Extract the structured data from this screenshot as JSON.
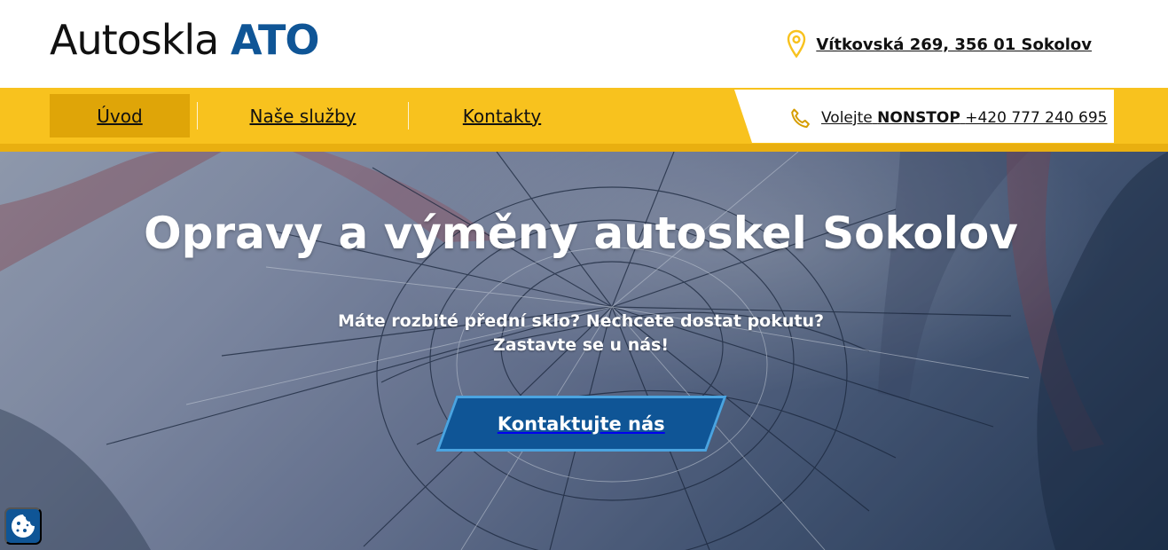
{
  "brand": {
    "name_main": "Autoskla",
    "name_accent": "ATO",
    "accent_color": "#0f5596"
  },
  "header": {
    "address": "Vítkovská 269, 356 01 Sokolov",
    "address_icon": "map-pin-icon"
  },
  "nav": {
    "items": [
      {
        "label": "Úvod",
        "active": true
      },
      {
        "label": "Naše služby",
        "active": false
      },
      {
        "label": "Kontakty",
        "active": false
      }
    ],
    "phone_prefix": "Volejte",
    "phone_nonstop": "NONSTOP",
    "phone_number": "+420 777 240 695",
    "phone_icon": "phone-icon"
  },
  "hero": {
    "title": "Opravy a výměny autoskel Sokolov",
    "subtitle_line1": "Máte rozbité přední sklo? Nechcete dostat pokutu?",
    "subtitle_line2": "Zastavte se u nás!",
    "cta": "Kontaktujte nás"
  },
  "colors": {
    "nav_yellow": "#f8c21e",
    "active_yellow": "#dfa508",
    "button_blue": "#0f5596",
    "button_border": "#4ba4e0"
  }
}
